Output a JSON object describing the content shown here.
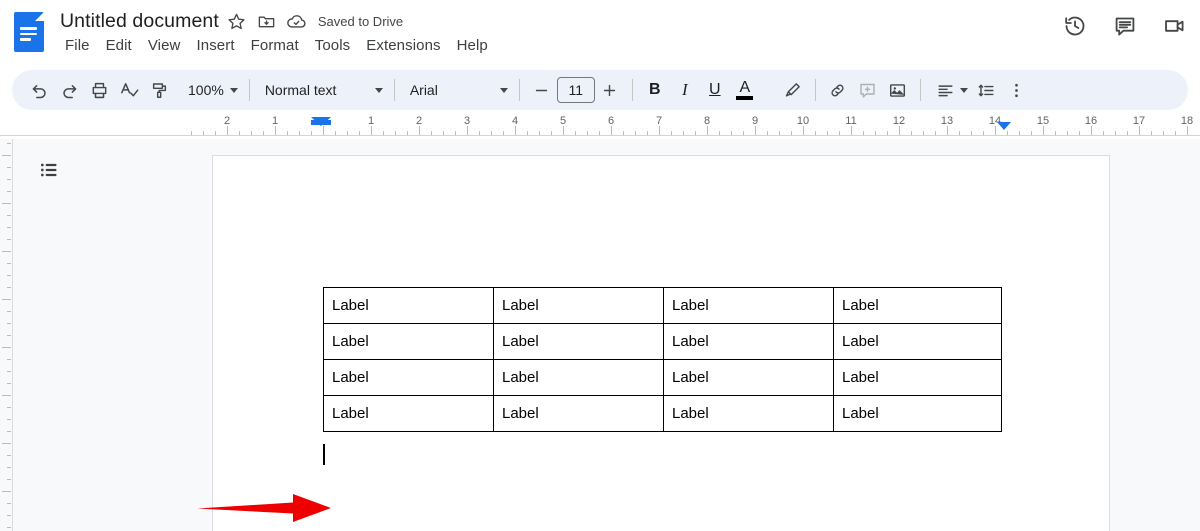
{
  "app": {
    "name": "Google Docs",
    "logo_icon": "google-docs-logo-icon"
  },
  "header": {
    "doc_title": "Untitled document",
    "star_icon": "star-icon",
    "move_folder_icon": "move-to-folder-icon",
    "cloud_icon": "cloud-saved-icon",
    "save_state": "Saved to Drive",
    "menus": [
      {
        "label": "File"
      },
      {
        "label": "Edit"
      },
      {
        "label": "View"
      },
      {
        "label": "Insert"
      },
      {
        "label": "Format"
      },
      {
        "label": "Tools"
      },
      {
        "label": "Extensions"
      },
      {
        "label": "Help"
      }
    ],
    "right_actions": [
      {
        "name": "version-history-icon",
        "label": "Version history"
      },
      {
        "name": "comment-history-icon",
        "label": "Open comment history"
      },
      {
        "name": "video-call-icon",
        "label": "Join a call"
      }
    ]
  },
  "toolbar": {
    "undo_label": "Undo",
    "redo_label": "Redo",
    "print_label": "Print",
    "spellcheck_label": "Spelling and grammar check",
    "paint_format_label": "Paint format",
    "zoom_value": "100%",
    "style_value": "Normal text",
    "font_value": "Arial",
    "font_size_value": "11",
    "decrease_font_label": "Decrease font size",
    "increase_font_label": "Increase font size",
    "bold_label": "B",
    "italic_label": "I",
    "underline_label": "U",
    "text_color_label": "A",
    "text_color_value": "#000000",
    "highlight_label": "Highlight color",
    "link_label": "Insert link",
    "comment_label": "Add comment",
    "image_label": "Insert image",
    "align_label": "Alignment",
    "line_spacing_label": "Line & paragraph spacing",
    "more_label": "More options"
  },
  "ruler": {
    "left_numbers": [
      "2",
      "1"
    ],
    "right_numbers": [
      "1",
      "2",
      "3",
      "4",
      "5",
      "6",
      "7",
      "8",
      "9",
      "10",
      "11",
      "12",
      "13",
      "14",
      "15",
      "16",
      "17",
      "18"
    ],
    "left_indent_marker": "left-indent-marker",
    "right_indent_marker": "right-indent-marker"
  },
  "canvas": {
    "outline_label": "Show document outline",
    "outline_icon": "document-outline-icon"
  },
  "document": {
    "table": {
      "columns": 4,
      "rows": [
        [
          "Label",
          "Label",
          "Label",
          "Label"
        ],
        [
          "Label",
          "Label",
          "Label",
          "Label"
        ],
        [
          "Label",
          "Label",
          "Label",
          "Label"
        ],
        [
          "Label",
          "Label",
          "Label",
          "Label"
        ]
      ]
    },
    "caret_visible": true
  },
  "annotation": {
    "arrow_color": "#ee0000",
    "arrow_direction": "right",
    "points_at": "table-row-3-cell-1"
  },
  "colors": {
    "brand_blue": "#1a73e8",
    "toolbar_bg": "#edf2fa",
    "canvas_bg": "#f8f9fa",
    "page_bg": "#ffffff",
    "annotation_red": "#ee0000"
  }
}
